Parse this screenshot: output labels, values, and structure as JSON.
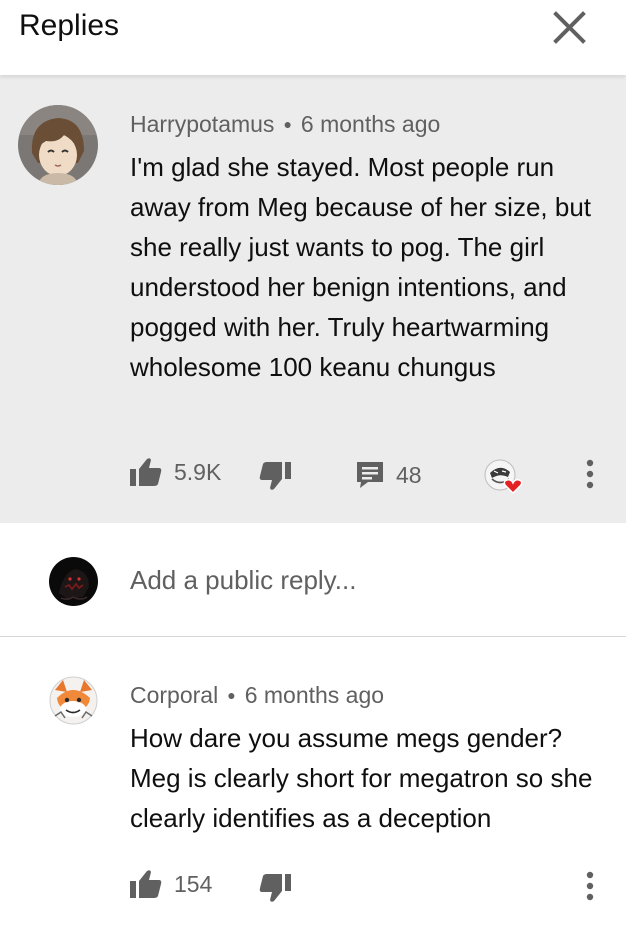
{
  "header": {
    "title": "Replies"
  },
  "comment": {
    "author": "Harrypotamus",
    "time": "6 months ago",
    "text": "I'm glad she stayed. Most people run away from Meg because of her size, but she really just wants to pog. The girl understood her benign intentions, and pogged with her. Truly heartwarming wholesome 100 keanu chungus",
    "likes": "5.9K",
    "replies": "48"
  },
  "reply_box": {
    "placeholder": "Add a public reply..."
  },
  "reply": {
    "author": "Corporal",
    "time": "6 months ago",
    "text": "How dare you assume megs gender? Meg is clearly short for megatron so she clearly identifies as a deception",
    "likes": "154"
  },
  "colors": {
    "highlight_bg": "#ececec",
    "meta_text": "#606060",
    "icon": "#606060",
    "heart": "#e52222"
  }
}
